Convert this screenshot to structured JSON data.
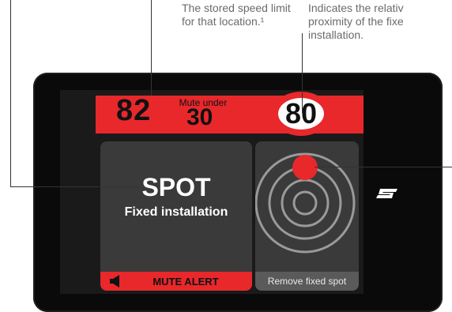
{
  "callouts": {
    "speed_limit": "The stored speed limit for that location.¹",
    "proximity_line1": "Indicates the relativ",
    "proximity_line2": "proximity of the fixe",
    "proximity_line3": "installation."
  },
  "display": {
    "current_speed": "82",
    "mute_label": "Mute under",
    "mute_value": "30",
    "speed_limit": "80"
  },
  "alert_panel": {
    "title": "SPOT",
    "subtitle": "Fixed installation",
    "mute_button": "MUTE ALERT"
  },
  "radar_panel": {
    "remove_button": "Remove fixed spot",
    "proximity_level": 0.9
  },
  "colors": {
    "accent_red": "#e8282b",
    "panel_gray": "#3a3a3a",
    "device_black": "#0a0a0a"
  },
  "icons": {
    "speaker": "speaker-icon",
    "logo": "brand-logo-icon",
    "radar": "radar-icon"
  }
}
